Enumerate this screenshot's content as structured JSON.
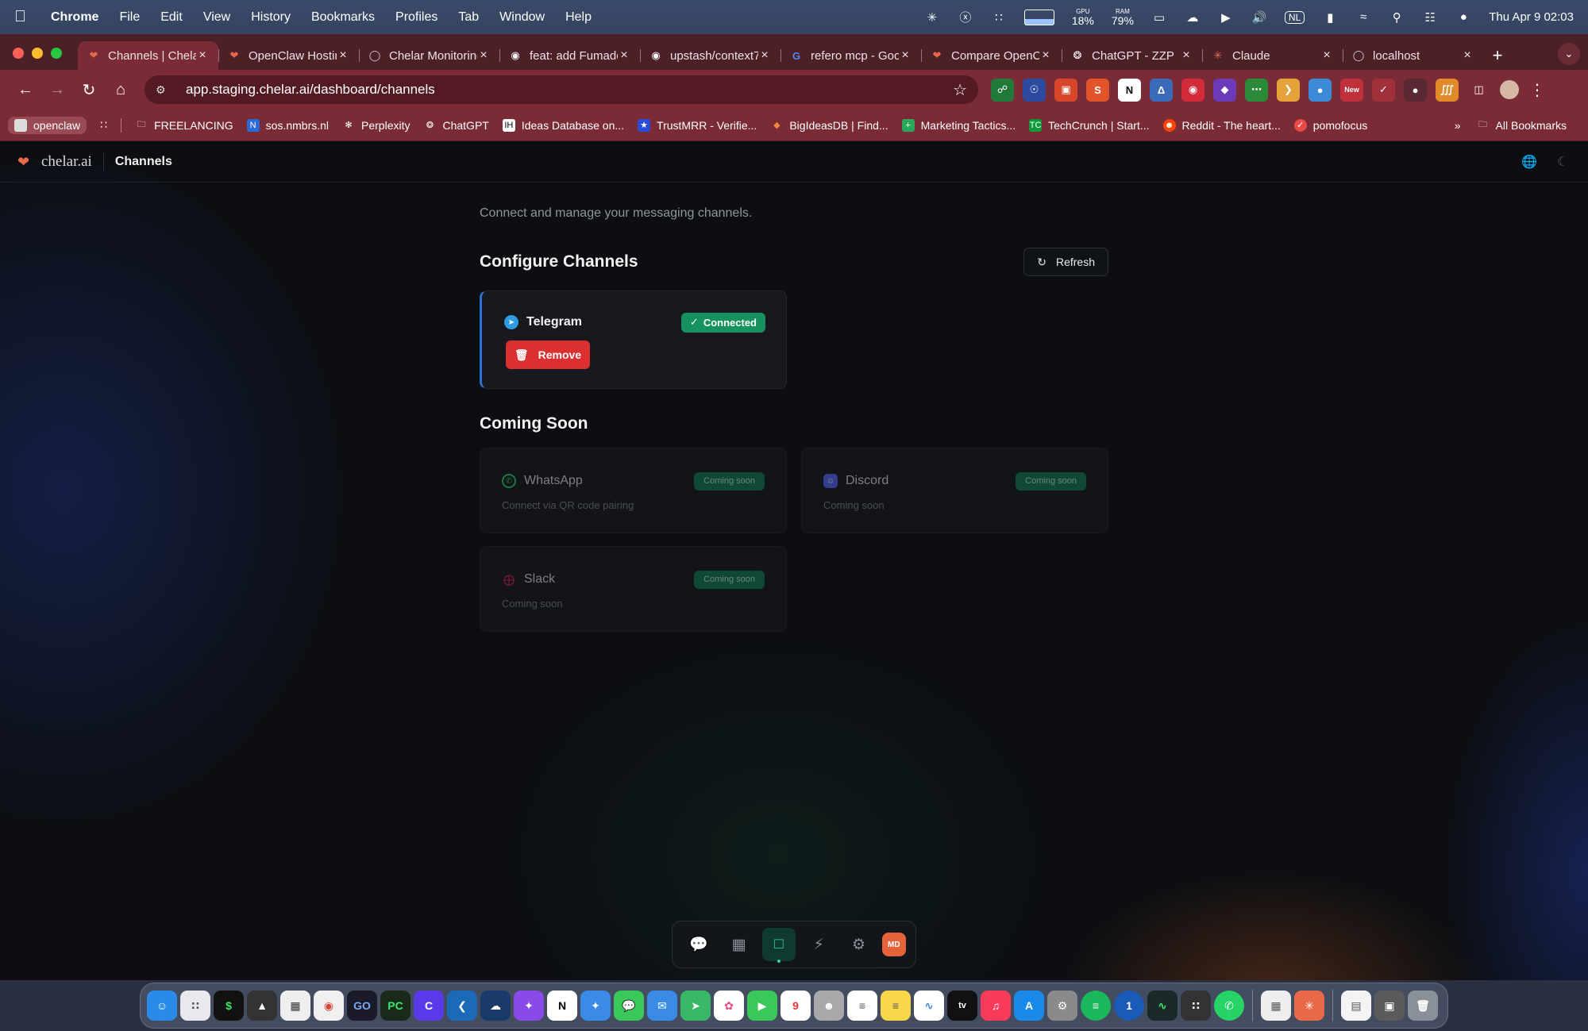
{
  "menubar": {
    "app_name": "Chrome",
    "menus": [
      "File",
      "Edit",
      "View",
      "History",
      "Bookmarks",
      "Profiles",
      "Tab",
      "Window",
      "Help"
    ],
    "gpu_label": "GPU",
    "gpu_value": "18%",
    "ram_label": "RAM",
    "ram_value": "79%",
    "input_source": "NL",
    "clock": "Thu Apr 9  02:03"
  },
  "tabs": [
    {
      "label": "Channels | Chelar",
      "active": true
    },
    {
      "label": "OpenClaw Hosting",
      "active": false
    },
    {
      "label": "Chelar Monitoring",
      "active": false
    },
    {
      "label": "feat: add Fumadocs",
      "active": false
    },
    {
      "label": "upstash/context7",
      "active": false
    },
    {
      "label": "refero mcp - Google",
      "active": false
    },
    {
      "label": "Compare OpenClaw",
      "active": false
    },
    {
      "label": "ChatGPT - ZZP",
      "active": false
    },
    {
      "label": "Claude",
      "active": false
    },
    {
      "label": "localhost",
      "active": false
    }
  ],
  "toolbar": {
    "url": "app.staging.chelar.ai/dashboard/channels",
    "extension_badge": "New"
  },
  "bookmarks": {
    "items": [
      "openclaw",
      "FREELANCING",
      "sos.nmbrs.nl",
      "Perplexity",
      "ChatGPT",
      "Ideas Database on...",
      "TrustMRR - Verifie...",
      "BigIdeasDB | Find...",
      "Marketing Tactics...",
      "TechCrunch | Start...",
      "Reddit - The heart...",
      "pomofocus"
    ],
    "all_bookmarks": "All Bookmarks"
  },
  "app": {
    "logo_text": "chelar.ai",
    "page_title": "Channels",
    "subtitle": "Connect and manage your messaging channels.",
    "configure_title": "Configure Channels",
    "refresh_label": "Refresh",
    "connected_channel": {
      "name": "Telegram",
      "status": "Connected",
      "remove_label": "Remove"
    },
    "coming_soon_title": "Coming Soon",
    "coming_soon": [
      {
        "name": "WhatsApp",
        "badge": "Coming soon",
        "description": "Connect via QR code pairing"
      },
      {
        "name": "Discord",
        "badge": "Coming soon",
        "description": "Coming soon"
      },
      {
        "name": "Slack",
        "badge": "Coming soon",
        "description": "Coming soon"
      }
    ],
    "dock_avatar": "MD"
  },
  "colors": {
    "accent_green": "#15925d",
    "danger_red": "#dc2f2f",
    "telegram_blue": "#2f9be0",
    "chrome_tab_bg": "#7a2b36"
  }
}
